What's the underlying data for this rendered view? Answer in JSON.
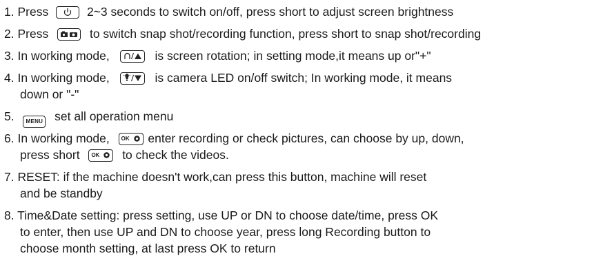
{
  "instructions": [
    {
      "number": "1.",
      "parts": [
        "Press",
        "2~3 seconds to switch on/off, press short to adjust screen brightness"
      ],
      "icons": [
        "power-icon"
      ]
    },
    {
      "number": "2.",
      "parts": [
        "Press",
        "to switch snap shot/recording function, press short to snap shot/recording"
      ],
      "icons": [
        "camera-video-icon"
      ]
    },
    {
      "number": "3.",
      "parts": [
        "In working mode,",
        "is screen rotation; in setting mode,it means up or\"+\""
      ],
      "icons": [
        "rotate-up-icon"
      ]
    },
    {
      "number": "4.",
      "parts": [
        "In working mode,",
        "is camera LED on/off switch; In working mode, it means",
        "down or \"-\""
      ],
      "icons": [
        "led-down-icon"
      ]
    },
    {
      "number": "5.",
      "parts": [
        "set all operation menu"
      ],
      "icons": [
        "menu-icon"
      ],
      "menu_label": "MENU"
    },
    {
      "number": "6.",
      "parts": [
        "In working mode,",
        "enter recording or check pictures, can choose by up, down,",
        "press short",
        "to check the videos."
      ],
      "icons": [
        "ok-icon",
        "ok-icon"
      ],
      "ok_label": "OK"
    },
    {
      "number": "7.",
      "parts": [
        "RESET: if the machine doesn't work,can press this button, machine will reset",
        "and be standby"
      ]
    },
    {
      "number": "8.",
      "parts": [
        "Time&Date setting: press setting, use UP or DN to choose date/time, press OK",
        "to enter, then use UP and DN to choose year, press long Recording button to",
        "choose month setting, at last press OK to return"
      ]
    }
  ],
  "colors": {
    "text": "#1a1a1a",
    "icon_border": "#222222"
  }
}
